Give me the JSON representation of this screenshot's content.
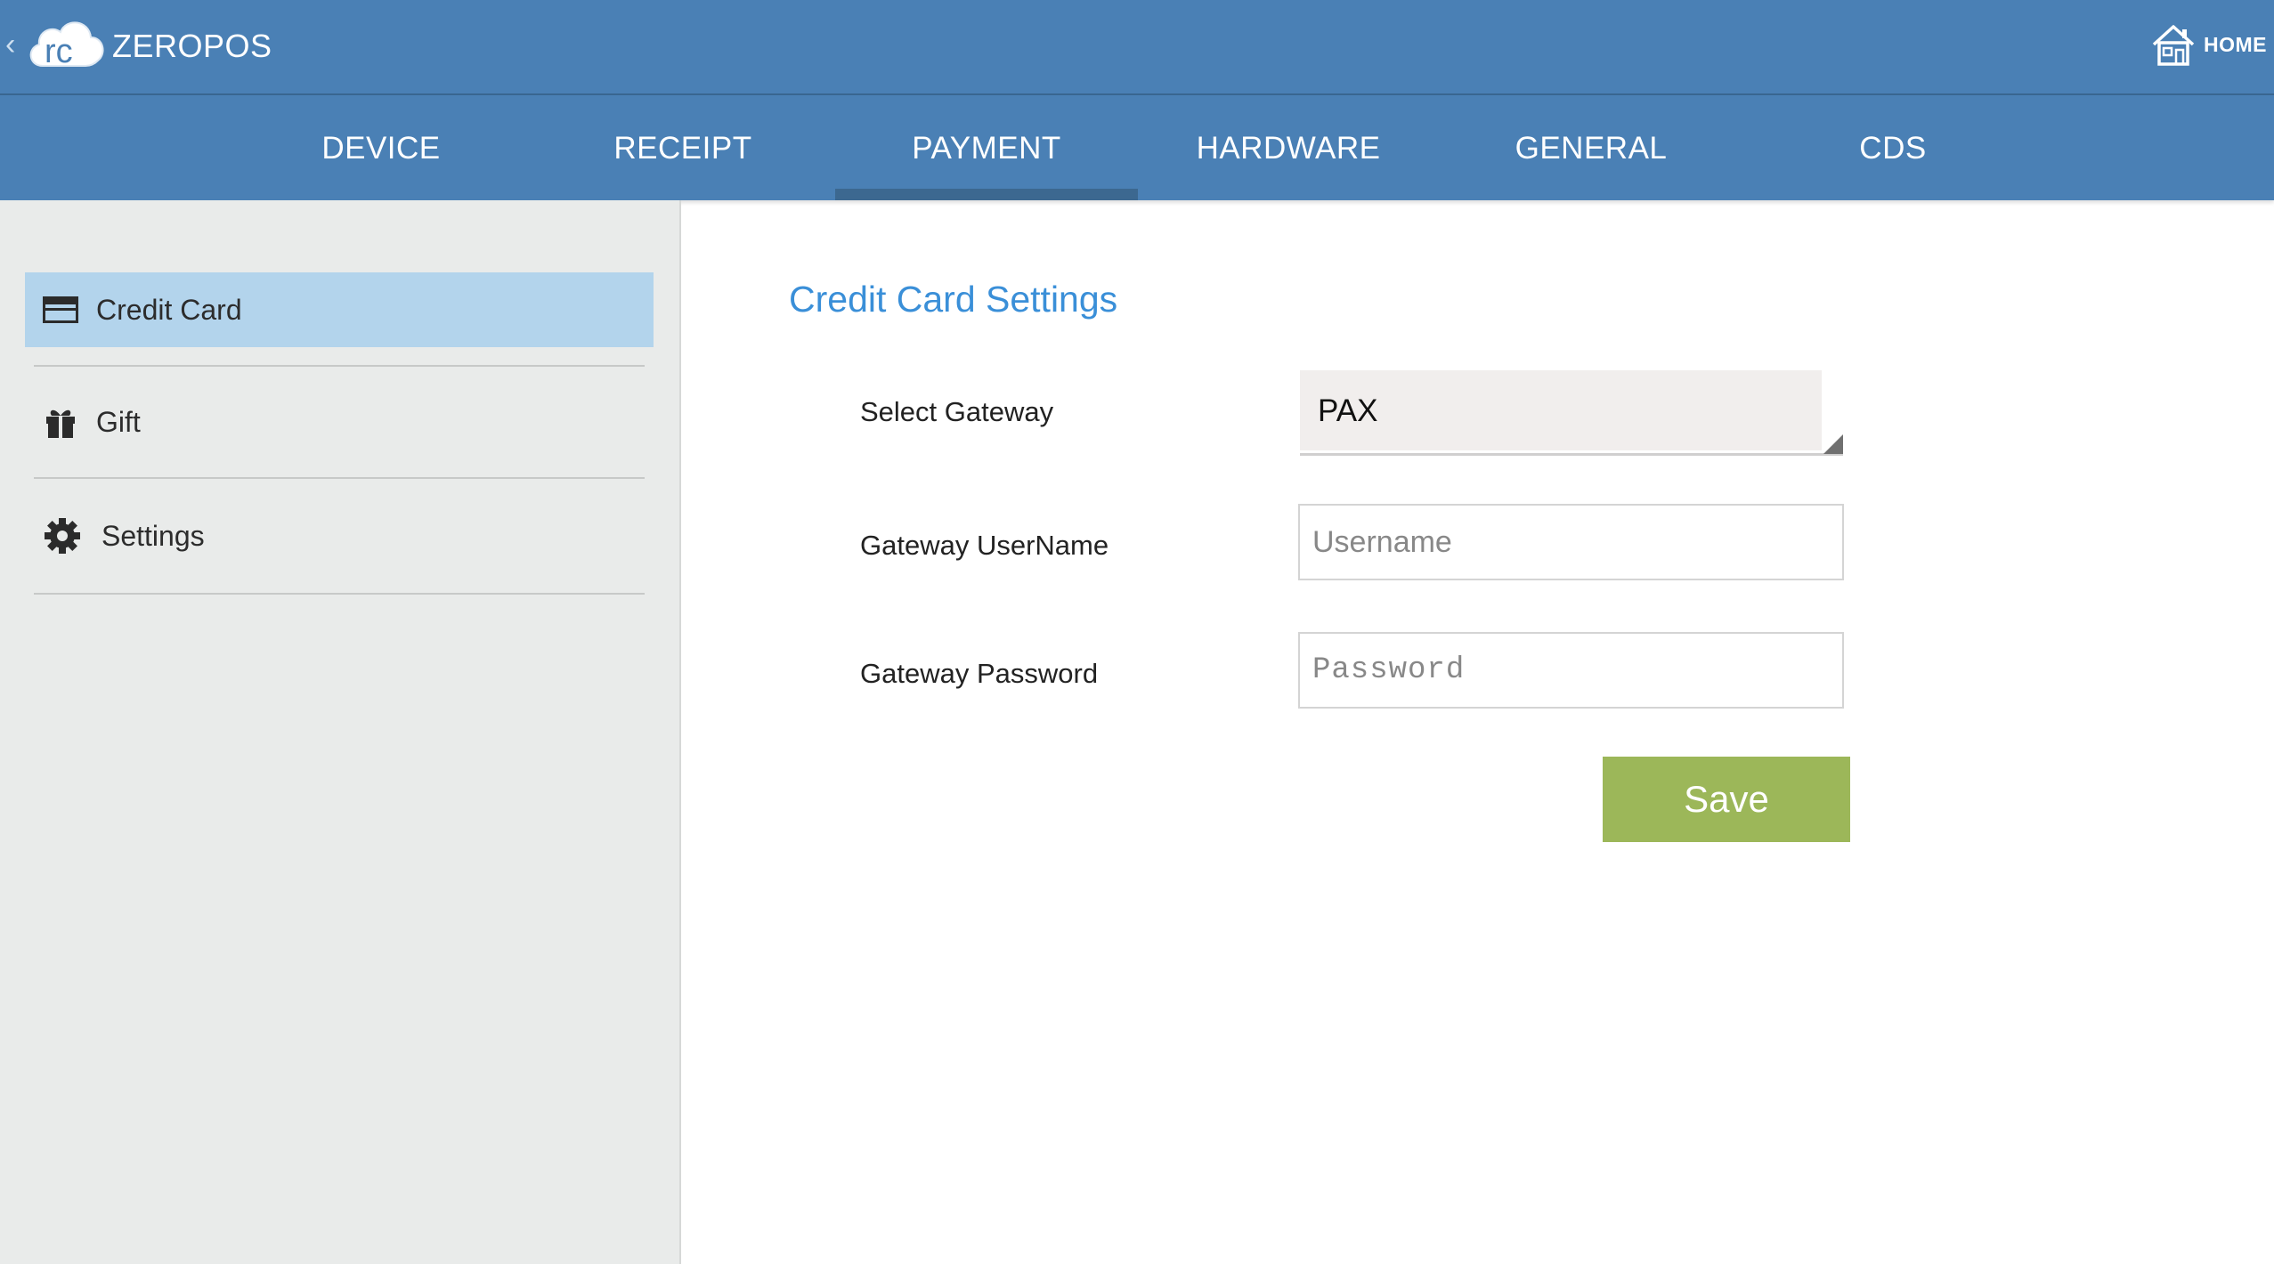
{
  "app": {
    "logo_text": "rc",
    "title": "ZEROPOS",
    "back_glyph": "‹",
    "home_label": "HOME",
    "colors": {
      "header_bg": "#4a80b5",
      "active_tab_indicator": "#3c6890",
      "sidebar_bg": "#e9ebea",
      "sidebar_active_bg": "#b3d4ec",
      "section_title": "#3a8fd8",
      "save_button": "#9cb759"
    }
  },
  "tabs": [
    {
      "label": "DEVICE",
      "active": false
    },
    {
      "label": "RECEIPT",
      "active": false
    },
    {
      "label": "PAYMENT",
      "active": true
    },
    {
      "label": "HARDWARE",
      "active": false
    },
    {
      "label": "GENERAL",
      "active": false
    },
    {
      "label": "CDS",
      "active": false
    }
  ],
  "sidebar": {
    "items": [
      {
        "label": "Credit Card",
        "icon": "credit-card-icon",
        "active": true
      },
      {
        "label": "Gift",
        "icon": "gift-icon",
        "active": false
      },
      {
        "label": "Settings",
        "icon": "gear-icon",
        "active": false
      }
    ]
  },
  "main": {
    "section_title": "Credit Card Settings",
    "gateway": {
      "label": "Select Gateway",
      "value": "PAX"
    },
    "username": {
      "label": "Gateway UserName",
      "value": "",
      "placeholder": "Username"
    },
    "password": {
      "label": "Gateway Password",
      "value": "",
      "placeholder": "Password"
    },
    "save_label": "Save"
  }
}
